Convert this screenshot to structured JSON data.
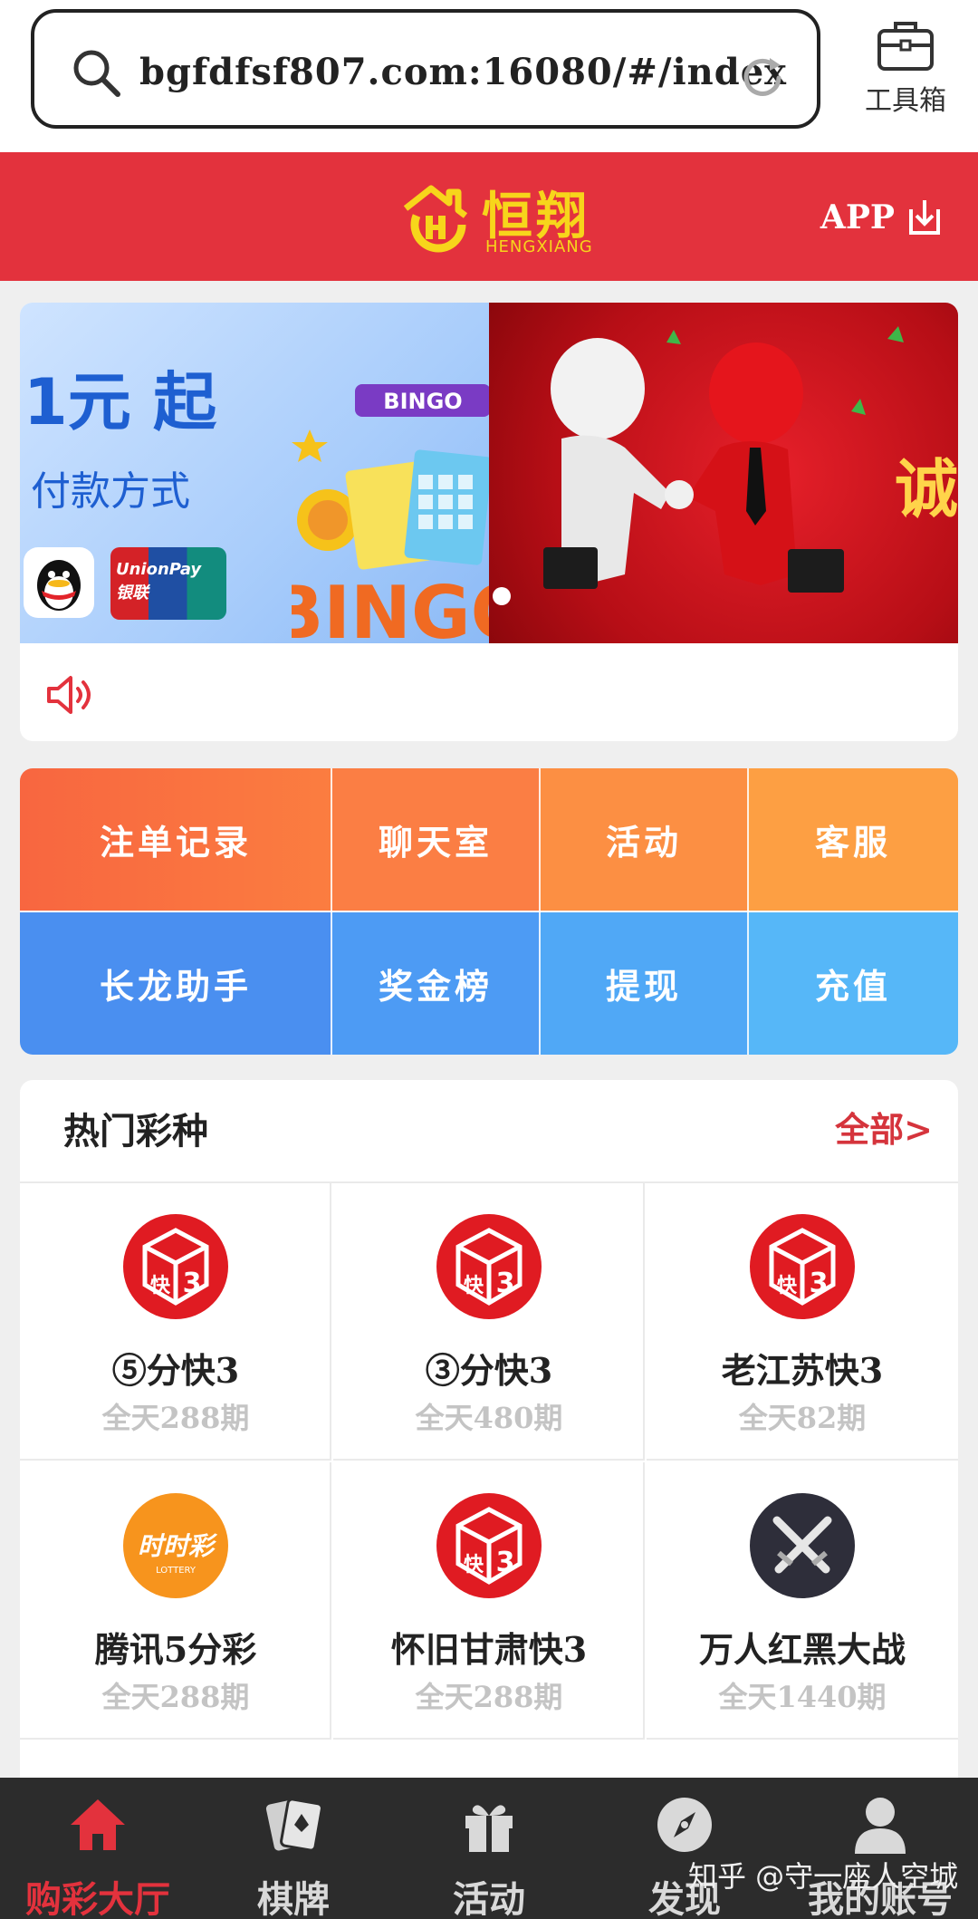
{
  "browser": {
    "url": "bgfdfsf807.com:16080/#/index",
    "toolbox_label": "工具箱"
  },
  "header": {
    "logo_cn": "恒翔",
    "logo_en": "HENGXIANG",
    "app_label": "APP"
  },
  "banner": {
    "promo_price": "1元 起",
    "promo_sub": "付款方式",
    "unionpay_text": "UnionPay 银联",
    "bingo_text": "BINGO",
    "right_text": "诚"
  },
  "quick_menu": [
    {
      "label": "注单记录"
    },
    {
      "label": "聊天室"
    },
    {
      "label": "活动"
    },
    {
      "label": "客服"
    },
    {
      "label": "长龙助手"
    },
    {
      "label": "奖金榜"
    },
    {
      "label": "提现"
    },
    {
      "label": "充值"
    }
  ],
  "hot_games": {
    "title": "热门彩种",
    "all_label": "全部>",
    "items": [
      {
        "name": "⑤分快3",
        "draws": "全天288期",
        "icon": "kuai3-dice-icon"
      },
      {
        "name": "③分快3",
        "draws": "全天480期",
        "icon": "kuai3-dice-icon"
      },
      {
        "name": "老江苏快3",
        "draws": "全天82期",
        "icon": "kuai3-dice-icon"
      },
      {
        "name": "腾讯5分彩",
        "draws": "全天288期",
        "icon": "shishicai-lottery-icon"
      },
      {
        "name": "怀旧甘肃快3",
        "draws": "全天288期",
        "icon": "kuai3-dice-icon"
      },
      {
        "name": "万人红黑大战",
        "draws": "全天1440期",
        "icon": "crossed-swords-icon"
      }
    ]
  },
  "bottom_nav": [
    {
      "label": "购彩大厅",
      "icon": "home-icon",
      "active": true
    },
    {
      "label": "棋牌",
      "icon": "cards-icon",
      "active": false
    },
    {
      "label": "活动",
      "icon": "gift-icon",
      "active": false
    },
    {
      "label": "发现",
      "icon": "compass-icon",
      "active": false
    },
    {
      "label": "我的账号",
      "icon": "user-icon",
      "active": false
    }
  ],
  "watermark": "知乎 @守一座人空城",
  "colors": {
    "brand_red": "#e3323d",
    "logo_gold": "#f7d51b",
    "orange": "#fb7d40",
    "blue": "#4d9bf4",
    "nav_bg": "#2c2c2c"
  }
}
